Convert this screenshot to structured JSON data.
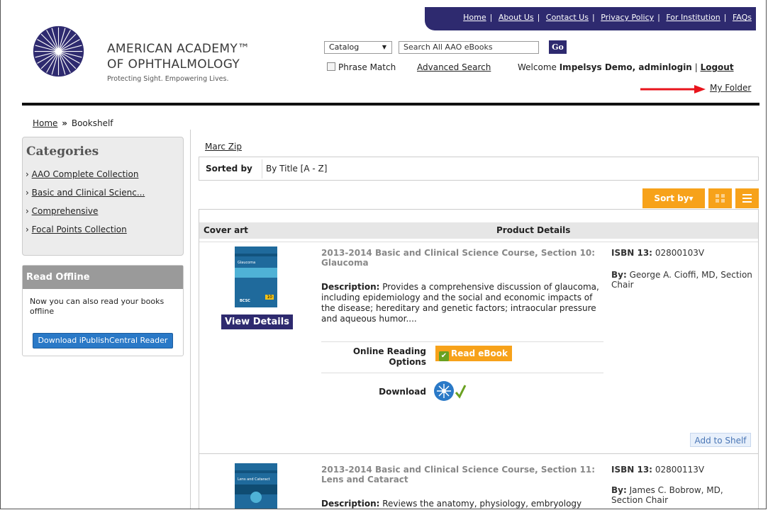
{
  "topnav": {
    "links": [
      "Home",
      "About Us",
      "Contact Us",
      "Privacy Policy",
      "For Institution",
      "FAQs"
    ]
  },
  "brand": {
    "line1": "AMERICAN ACADEMY™",
    "line2": "OF OPHTHALMOLOGY",
    "tagline": "Protecting Sight. Empowering Lives."
  },
  "search": {
    "catalog": "Catalog",
    "placeholder": "Search All AAO eBooks",
    "go": "Go",
    "phrase_match": "Phrase Match",
    "advanced": "Advanced Search"
  },
  "user": {
    "welcome": "Welcome",
    "name": "Impelsys Demo, adminlogin",
    "separator": "|",
    "logout": "Logout",
    "my_folder": "My Folder"
  },
  "breadcrumb": {
    "home": "Home",
    "sep": "»",
    "current": "Bookshelf"
  },
  "categories": {
    "title": "Categories",
    "items": [
      "AAO Complete Collection",
      "Basic and Clinical Scienc...",
      "Comprehensive",
      "Focal Points Collection"
    ]
  },
  "offline": {
    "title": "Read Offline",
    "text": "Now you can also read your books offline",
    "button": "Download iPublishCentral Reader"
  },
  "main": {
    "user_link": "Marc Zip",
    "sorted_by_label": "Sorted by",
    "sorted_by_value": "By Title [A - Z]",
    "sort_button": "Sort by▾",
    "headers": {
      "cover": "Cover art",
      "details": "Product Details"
    },
    "view_details": "View Details",
    "online_reading_label": "Online Reading Options",
    "read_ebook": "Read eBook",
    "download_label": "Download",
    "add_to_shelf": "Add to Shelf",
    "isbn_label": "ISBN 13:",
    "by_label": "By:",
    "desc_label": "Description:"
  },
  "products": [
    {
      "title": "2013-2014 Basic and Clinical Science Course, Section 10: Glaucoma",
      "isbn": "02800103V",
      "author": "George A. Cioffi, MD, Section Chair",
      "description": "Provides a comprehensive discussion of glaucoma, including epidemiology and the social and economic impacts of the disease; hereditary and genetic factors; intraocular pressure and aqueous humor....",
      "cover_label": "Glaucoma",
      "cover_number": "10"
    },
    {
      "title": "2013-2014 Basic and Clinical Science Course, Section 11: Lens and Cataract",
      "isbn": "02800113V",
      "author": "James C. Bobrow, MD, Section Chair",
      "description": "Reviews the anatomy, physiology, embryology",
      "cover_label": "Lens and Cataract"
    }
  ],
  "colors": {
    "navy": "#2e2a6f",
    "orange": "#f7a21a",
    "blue": "#2a79c7",
    "red_arrow": "#e8141c"
  }
}
